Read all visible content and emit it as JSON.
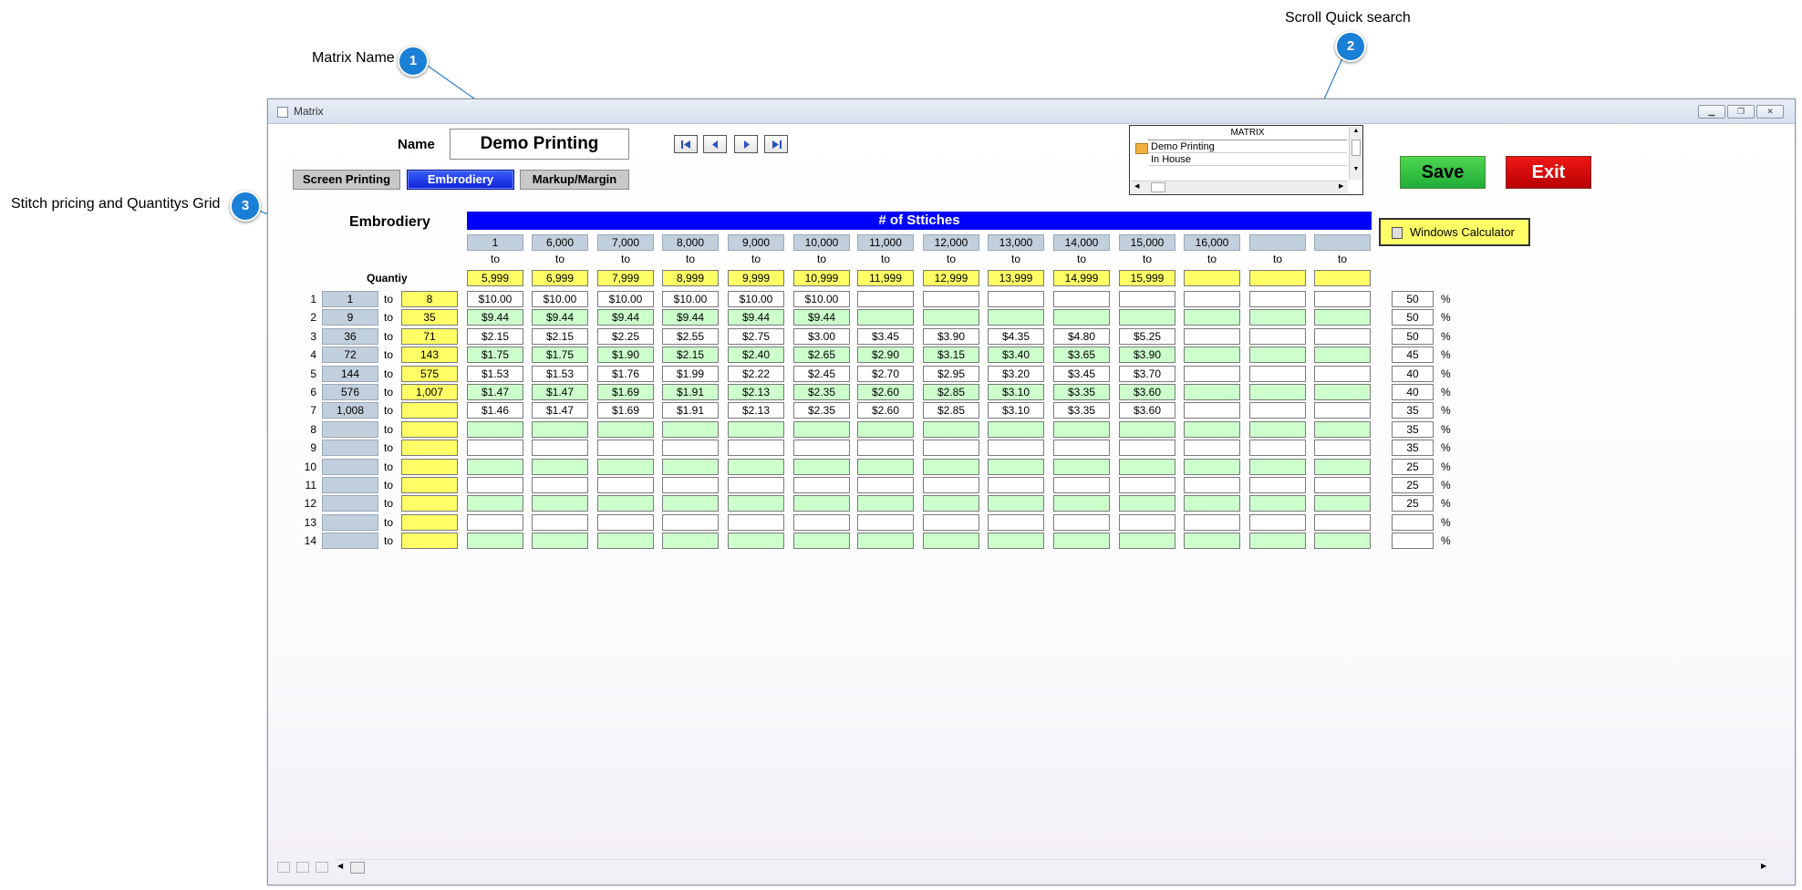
{
  "callouts": [
    {
      "num": "1",
      "label": "Matrix Name"
    },
    {
      "num": "2",
      "label": "Scroll Quick search"
    },
    {
      "num": "3",
      "label": "Stitch pricing and Quantitys Grid"
    }
  ],
  "window": {
    "title": "Matrix"
  },
  "name_label": "Name",
  "name_value": "Demo Printing",
  "tabs": [
    "Screen Printing",
    "Embrodiery",
    "Markup/Margin"
  ],
  "quick_search": {
    "header": "MATRIX",
    "items": [
      "Demo Printing",
      "In House"
    ]
  },
  "buttons": {
    "save": "Save",
    "exit": "Exit",
    "calculator": "Windows Calculator"
  },
  "grid": {
    "section_title": "Embrodiery",
    "stitch_header": "# of Sttiches",
    "quantity_label": "Quantiy",
    "to": "to",
    "pct_sign": "%",
    "stitch_from": [
      "1",
      "6,000",
      "7,000",
      "8,000",
      "9,000",
      "10,000",
      "11,000",
      "12,000",
      "13,000",
      "14,000",
      "15,000",
      "16,000",
      "",
      ""
    ],
    "stitch_to": [
      "5,999",
      "6,999",
      "7,999",
      "8,999",
      "9,999",
      "10,999",
      "11,999",
      "12,999",
      "13,999",
      "14,999",
      "15,999",
      "",
      "",
      ""
    ],
    "rows": [
      {
        "num": "1",
        "from": "1",
        "to": "8",
        "prices": [
          "$10.00",
          "$10.00",
          "$10.00",
          "$10.00",
          "$10.00",
          "$10.00",
          "",
          "",
          "",
          "",
          "",
          "",
          "",
          ""
        ],
        "markup": "50"
      },
      {
        "num": "2",
        "from": "9",
        "to": "35",
        "prices": [
          "$9.44",
          "$9.44",
          "$9.44",
          "$9.44",
          "$9.44",
          "$9.44",
          "",
          "",
          "",
          "",
          "",
          "",
          "",
          ""
        ],
        "markup": "50"
      },
      {
        "num": "3",
        "from": "36",
        "to": "71",
        "prices": [
          "$2.15",
          "$2.15",
          "$2.25",
          "$2.55",
          "$2.75",
          "$3.00",
          "$3.45",
          "$3.90",
          "$4.35",
          "$4.80",
          "$5.25",
          "",
          "",
          ""
        ],
        "markup": "50"
      },
      {
        "num": "4",
        "from": "72",
        "to": "143",
        "prices": [
          "$1.75",
          "$1.75",
          "$1.90",
          "$2.15",
          "$2.40",
          "$2.65",
          "$2.90",
          "$3.15",
          "$3.40",
          "$3.65",
          "$3.90",
          "",
          "",
          ""
        ],
        "markup": "45"
      },
      {
        "num": "5",
        "from": "144",
        "to": "575",
        "prices": [
          "$1.53",
          "$1.53",
          "$1.76",
          "$1.99",
          "$2.22",
          "$2.45",
          "$2.70",
          "$2.95",
          "$3.20",
          "$3.45",
          "$3.70",
          "",
          "",
          ""
        ],
        "markup": "40"
      },
      {
        "num": "6",
        "from": "576",
        "to": "1,007",
        "prices": [
          "$1.47",
          "$1.47",
          "$1.69",
          "$1.91",
          "$2.13",
          "$2.35",
          "$2.60",
          "$2.85",
          "$3.10",
          "$3.35",
          "$3.60",
          "",
          "",
          ""
        ],
        "markup": "40"
      },
      {
        "num": "7",
        "from": "1,008",
        "to": "",
        "prices": [
          "$1.46",
          "$1.47",
          "$1.69",
          "$1.91",
          "$2.13",
          "$2.35",
          "$2.60",
          "$2.85",
          "$3.10",
          "$3.35",
          "$3.60",
          "",
          "",
          ""
        ],
        "markup": "35"
      },
      {
        "num": "8",
        "from": "",
        "to": "",
        "prices": [
          "",
          "",
          "",
          "",
          "",
          "",
          "",
          "",
          "",
          "",
          "",
          "",
          "",
          ""
        ],
        "markup": "35"
      },
      {
        "num": "9",
        "from": "",
        "to": "",
        "prices": [
          "",
          "",
          "",
          "",
          "",
          "",
          "",
          "",
          "",
          "",
          "",
          "",
          "",
          ""
        ],
        "markup": "35"
      },
      {
        "num": "10",
        "from": "",
        "to": "",
        "prices": [
          "",
          "",
          "",
          "",
          "",
          "",
          "",
          "",
          "",
          "",
          "",
          "",
          "",
          ""
        ],
        "markup": "25"
      },
      {
        "num": "11",
        "from": "",
        "to": "",
        "prices": [
          "",
          "",
          "",
          "",
          "",
          "",
          "",
          "",
          "",
          "",
          "",
          "",
          "",
          ""
        ],
        "markup": "25"
      },
      {
        "num": "12",
        "from": "",
        "to": "",
        "prices": [
          "",
          "",
          "",
          "",
          "",
          "",
          "",
          "",
          "",
          "",
          "",
          "",
          "",
          ""
        ],
        "markup": "25"
      },
      {
        "num": "13",
        "from": "",
        "to": "",
        "prices": [
          "",
          "",
          "",
          "",
          "",
          "",
          "",
          "",
          "",
          "",
          "",
          "",
          "",
          ""
        ],
        "markup": ""
      },
      {
        "num": "14",
        "from": "",
        "to": "",
        "prices": [
          "",
          "",
          "",
          "",
          "",
          "",
          "",
          "",
          "",
          "",
          "",
          "",
          "",
          ""
        ],
        "markup": ""
      }
    ]
  }
}
